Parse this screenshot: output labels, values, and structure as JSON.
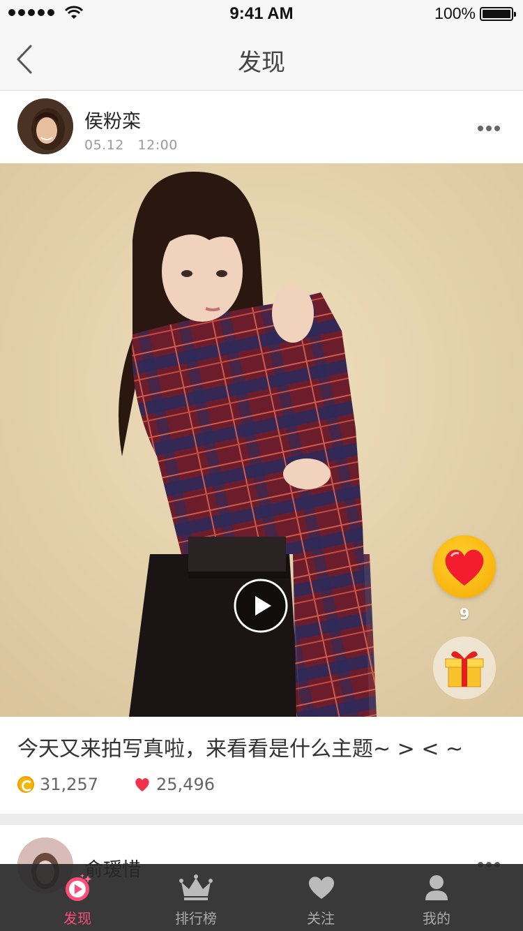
{
  "status_bar": {
    "time": "9:41 AM",
    "battery_percent": "100%"
  },
  "nav": {
    "title": "发现",
    "back_icon": "chevron-left-icon"
  },
  "post": {
    "username": "侯粉栾",
    "date": "05.12",
    "time": "12:00",
    "like_count": "9",
    "caption": "今天又来拍写真啦，来看看是什么主题~ > < ~",
    "coins": "31,257",
    "likes": "25,496"
  },
  "next_post": {
    "username": "俞瑷惜"
  },
  "tabs": [
    {
      "label": "发现",
      "icon": "play-icon",
      "active": true
    },
    {
      "label": "排行榜",
      "icon": "crown-icon",
      "active": false
    },
    {
      "label": "关注",
      "icon": "heart-icon",
      "active": false
    },
    {
      "label": "我的",
      "icon": "user-icon",
      "active": false
    }
  ],
  "colors": {
    "accent": "#ff4d7c",
    "tabbar_bg": "#2a2a2a",
    "like_button": "#f8b400"
  }
}
